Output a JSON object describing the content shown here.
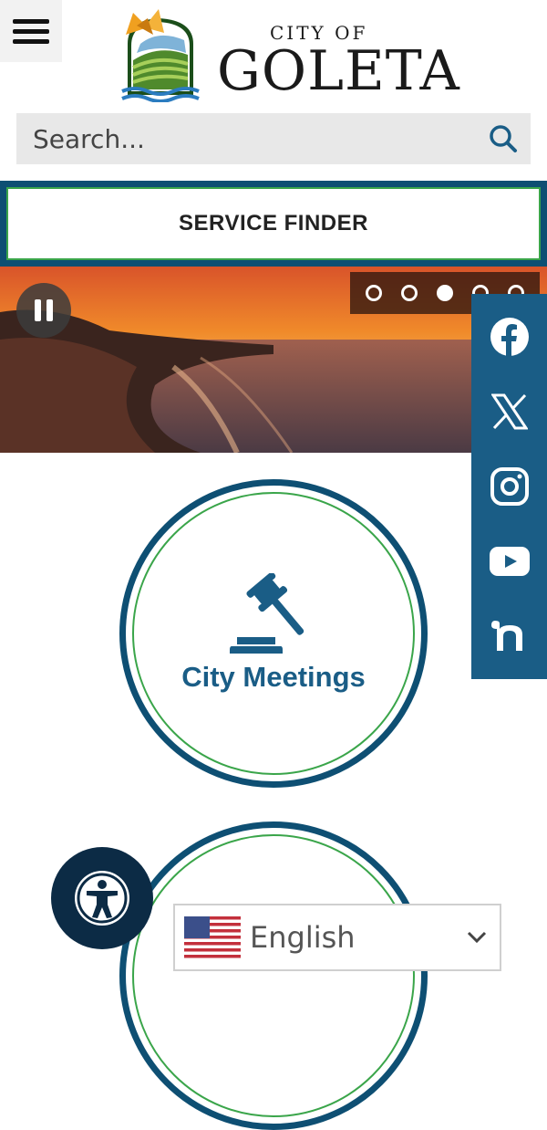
{
  "header": {
    "menu_icon": "hamburger-icon",
    "logo": {
      "line1": "CITY OF",
      "line2": "GOLETA"
    }
  },
  "search": {
    "placeholder": "Search...",
    "icon": "search-icon"
  },
  "service_finder": {
    "label": "SERVICE FINDER"
  },
  "hero": {
    "pause_icon": "pause-icon",
    "slide_count": 5,
    "active_slide": 3
  },
  "social": {
    "items": [
      {
        "name": "facebook-icon"
      },
      {
        "name": "x-icon"
      },
      {
        "name": "instagram-icon"
      },
      {
        "name": "youtube-icon"
      },
      {
        "name": "nextdoor-icon"
      }
    ]
  },
  "tiles": [
    {
      "label": "City Meetings",
      "icon": "gavel-icon"
    }
  ],
  "language": {
    "selected": "English",
    "flag": "us-flag-icon"
  },
  "colors": {
    "navy": "#0e4f73",
    "social_blue": "#1a5d86",
    "accent_green": "#3aa54a",
    "a11y_dark": "#0c2b45"
  }
}
